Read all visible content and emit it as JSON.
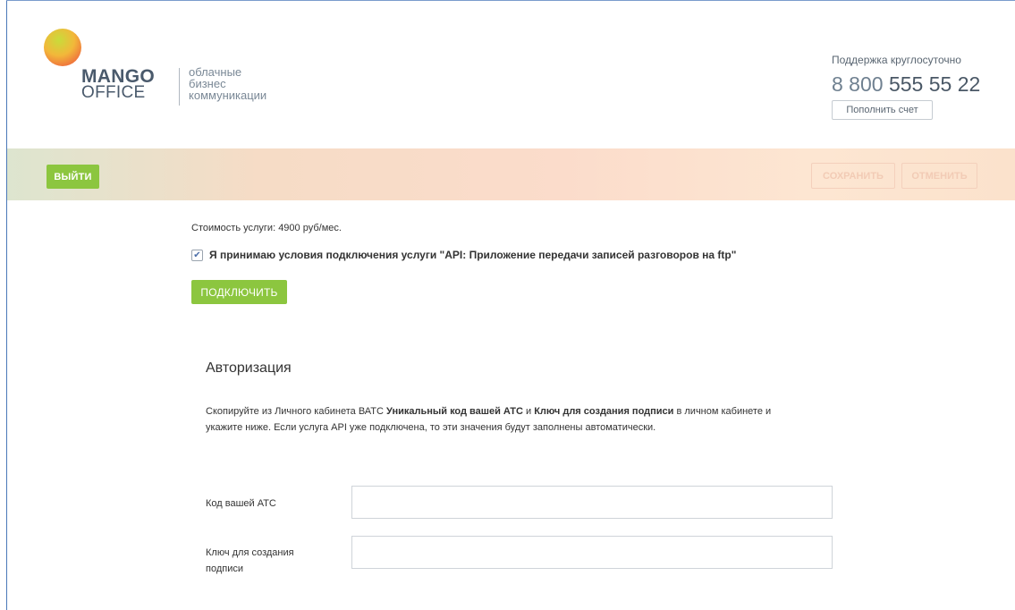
{
  "header": {
    "logo_line1": "MANGO",
    "logo_line2": "OFFICE",
    "tagline": [
      "облачные",
      "бизнес",
      "коммуникации"
    ],
    "support_label": "Поддержка круглосуточно",
    "phone_prefix": "8 800",
    "phone_main": "555 55 22",
    "topup_label": "Пополнить счет"
  },
  "toolbar": {
    "exit_label": "ВЫЙТИ",
    "save_label": "СОХРАНИТЬ",
    "cancel_label": "ОТМЕНИТЬ"
  },
  "service": {
    "cost_text": "Стоимость услуги: 4900 руб/мес.",
    "terms_checked": true,
    "checkmark": "✔",
    "terms_text": "Я принимаю условия подключения услуги \"API: Приложение передачи записей разговоров на ftp\"",
    "connect_label": "ПОДКЛЮЧИТЬ"
  },
  "auth": {
    "title": "Авторизация",
    "desc_part1": "Скопируйте из Личного кабинета ВАТС ",
    "desc_bold1": "Уникальный код вашей АТС",
    "desc_part2": " и ",
    "desc_bold2": "Ключ для создания подписи",
    "desc_part3": " в личном кабинете и укажите ниже. Если услуга API уже подключена, то эти значения будут заполнены автоматически.",
    "code_label": "Код вашей АТС",
    "code_value": "",
    "key_label": "Ключ для создания подписи",
    "key_value": ""
  },
  "colors": {
    "accent_green": "#8cc63f",
    "frame_blue": "#4a78b8"
  }
}
